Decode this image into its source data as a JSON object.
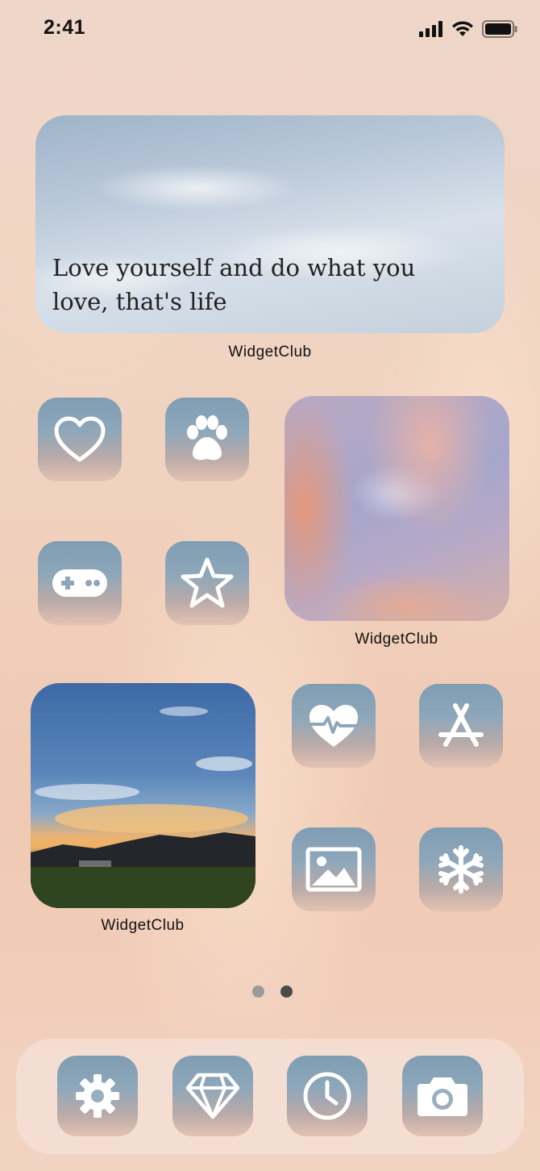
{
  "status_bar": {
    "time": "2:41"
  },
  "quote_widget": {
    "text": "Love yourself and do what you love, that's life",
    "label": "WidgetClub"
  },
  "sunset_widget": {
    "label": "WidgetClub"
  },
  "landscape_widget": {
    "label": "WidgetClub"
  },
  "apps": [
    {
      "icon": "heart-icon"
    },
    {
      "icon": "paw-icon"
    },
    {
      "icon": "gamepad-icon"
    },
    {
      "icon": "star-icon"
    },
    {
      "icon": "health-heartbeat-icon"
    },
    {
      "icon": "app-store-icon"
    },
    {
      "icon": "photos-icon"
    },
    {
      "icon": "snowflake-icon"
    }
  ],
  "page_dots": {
    "count": 2,
    "active_index": 1
  },
  "dock": [
    {
      "icon": "gear-icon"
    },
    {
      "icon": "diamond-icon"
    },
    {
      "icon": "clock-icon"
    },
    {
      "icon": "camera-icon"
    }
  ],
  "colors": {
    "icon_top": "#7f9db3",
    "icon_bottom": "#e4c2b2",
    "dot_inactive": "#9a9a9a",
    "dot_active": "#4a4a4a"
  }
}
